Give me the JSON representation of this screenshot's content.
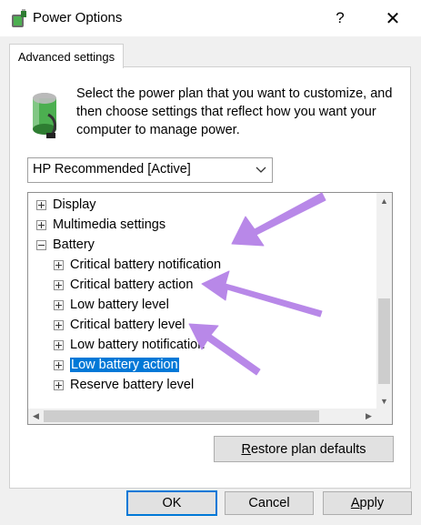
{
  "window": {
    "title": "Power Options",
    "help_label": "?",
    "close_label": "✕"
  },
  "tab": {
    "label": "Advanced settings"
  },
  "intro_text": "Select the power plan that you want to customize, and then choose settings that reflect how you want your computer to manage power.",
  "plan_select": {
    "value": "HP Recommended [Active]"
  },
  "tree": {
    "items": [
      {
        "label": "Display",
        "expander": "plus"
      },
      {
        "label": "Multimedia settings",
        "expander": "plus"
      },
      {
        "label": "Battery",
        "expander": "minus"
      },
      {
        "label": "Critical battery notification",
        "expander": "plus"
      },
      {
        "label": "Critical battery action",
        "expander": "plus"
      },
      {
        "label": "Low battery level",
        "expander": "plus"
      },
      {
        "label": "Critical battery level",
        "expander": "plus"
      },
      {
        "label": "Low battery notification",
        "expander": "plus"
      },
      {
        "label": "Low battery action",
        "expander": "plus",
        "selected": true
      },
      {
        "label": "Reserve battery level",
        "expander": "plus"
      }
    ]
  },
  "buttons": {
    "restore": {
      "first": "R",
      "rest": "estore plan defaults"
    },
    "ok": "OK",
    "cancel": "Cancel",
    "apply": {
      "first": "A",
      "rest": "pply"
    }
  },
  "accent_color": "#0078d7",
  "annotation_color": "#b888e8",
  "icons": [
    "power-options-icon",
    "battery-power-icon",
    "chevron-down-icon",
    "expand-icon",
    "collapse-icon"
  ]
}
